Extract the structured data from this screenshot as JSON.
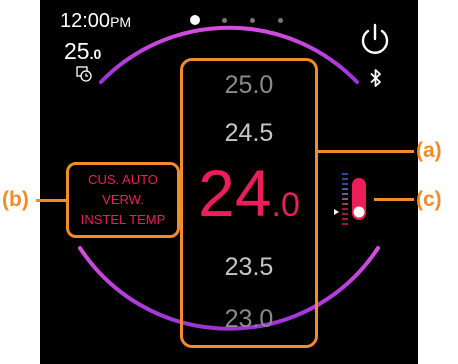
{
  "status": {
    "time": "12:00",
    "ampm": "PM",
    "set_temp_int": "25",
    "set_temp_dec": ".0"
  },
  "page_indicator": {
    "count": 4,
    "active_index": 0
  },
  "temperature_list": {
    "values": [
      "25.0",
      "24.5",
      "23.5",
      "23.0"
    ],
    "current_int": "24",
    "current_dec": ".0"
  },
  "mode_label": {
    "lines": [
      "CUS. AUTO",
      "VERW.",
      "INSTEL TEMP"
    ]
  },
  "callouts": {
    "a": "(a)",
    "b": "(b)",
    "c": "(c)"
  },
  "icons": {
    "timer": "timer-icon",
    "power": "power-icon",
    "bluetooth": "bluetooth-icon",
    "slider": "slider-toggle-icon"
  },
  "colors": {
    "background": "#000000",
    "accent_temp": "#ea1f5a",
    "arc": "#b43cdc",
    "callout": "#f28c2a",
    "slider_scale_top": "#3a6bd9",
    "slider_scale_bottom": "#ea1f5a"
  }
}
